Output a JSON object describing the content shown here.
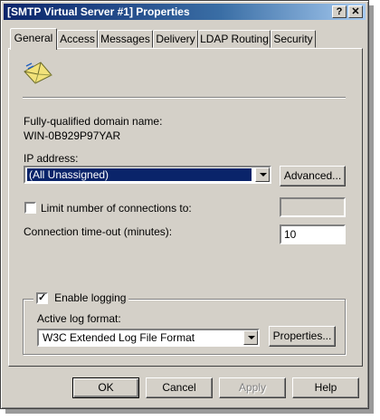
{
  "window": {
    "title": "[SMTP Virtual Server #1] Properties",
    "help_button": "?",
    "close_button": "✕"
  },
  "tabs": [
    {
      "label": "General",
      "active": true
    },
    {
      "label": "Access"
    },
    {
      "label": "Messages"
    },
    {
      "label": "Delivery"
    },
    {
      "label": "LDAP Routing"
    },
    {
      "label": "Security"
    }
  ],
  "general": {
    "icon": "smtp-envelope-icon",
    "fqdn_label": "Fully-qualified domain name:",
    "fqdn_value": "WIN-0B929P97YAR",
    "ip_label": "IP address:",
    "ip_value": "(All Unassigned)",
    "advanced_button": "Advanced...",
    "limit_connections_label": "Limit number of connections to:",
    "limit_connections_checked": false,
    "limit_connections_value": "",
    "timeout_label": "Connection time-out (minutes):",
    "timeout_value": "10",
    "enable_logging_label": "Enable logging",
    "enable_logging_checked": true,
    "log_format_label": "Active log format:",
    "log_format_value": "W3C Extended Log File Format",
    "properties_button": "Properties..."
  },
  "footer": {
    "ok": "OK",
    "cancel": "Cancel",
    "apply": "Apply",
    "help": "Help"
  },
  "colors": {
    "titlebar_start": "#0a246a",
    "titlebar_end": "#a6caf0",
    "face": "#d4d0c8"
  }
}
